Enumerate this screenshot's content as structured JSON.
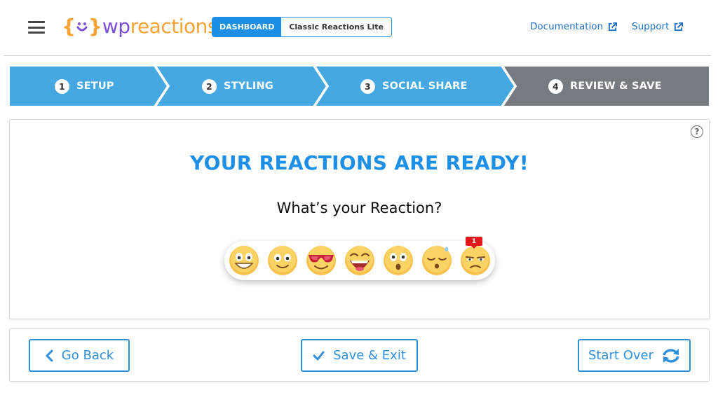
{
  "header": {
    "logo": {
      "wp": "wp",
      "reactions": "reactions"
    },
    "breadcrumb": {
      "active": "DASHBOARD",
      "current": "Classic Reactions Lite"
    },
    "links": {
      "documentation": "Documentation",
      "support": "Support"
    }
  },
  "steps": [
    {
      "num": "1",
      "label": "SETUP",
      "state": "done"
    },
    {
      "num": "2",
      "label": "STYLING",
      "state": "done"
    },
    {
      "num": "3",
      "label": "SOCIAL SHARE",
      "state": "done"
    },
    {
      "num": "4",
      "label": "REVIEW & SAVE",
      "state": "current"
    }
  ],
  "main": {
    "title": "YOUR REACTIONS ARE READY!",
    "subtitle": "What’s your Reaction?",
    "help_icon": "question-circle-icon",
    "reactions": [
      {
        "icon": "grinning-face-icon"
      },
      {
        "icon": "smiling-face-icon"
      },
      {
        "icon": "sunglasses-face-icon"
      },
      {
        "icon": "laughing-face-icon"
      },
      {
        "icon": "surprised-face-icon"
      },
      {
        "icon": "sleepy-face-icon"
      },
      {
        "icon": "unamused-face-icon",
        "count": "1"
      }
    ]
  },
  "footer": {
    "go_back": "Go Back",
    "save_exit": "Save & Exit",
    "start_over": "Start Over"
  },
  "colors": {
    "accent": "#1e8fe6",
    "step_done": "#45a8e0",
    "step_current": "#757b80",
    "logo_orange": "#f7a234",
    "logo_purple": "#7b4fd6",
    "badge_red": "#e3161b"
  }
}
